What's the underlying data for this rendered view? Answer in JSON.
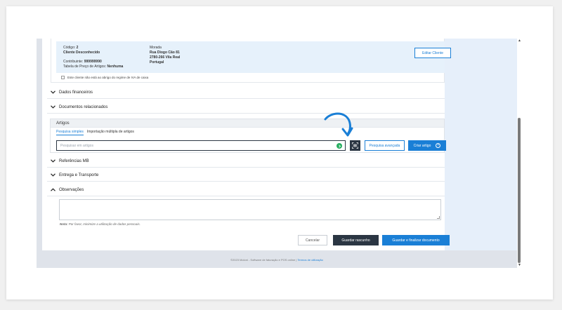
{
  "customer": {
    "code_label": "Código:",
    "code_value": "2",
    "name": "Cliente Desconhecido",
    "taxpayer_label": "Contribuinte:",
    "taxpayer_value": "999999990",
    "price_table_label": "Tabela de Preço de Artigos:",
    "price_table_value": "Nenhuma",
    "address_label": "Morada",
    "address_line1": "Rua Diogo Cão 81",
    "address_line2": "2780-266 Vila Real",
    "address_line3": "Portugal",
    "edit_button": "Editar Cliente",
    "vat_checkbox_label": "Este cliente não está ao abrigo do regime de IVA de caixa"
  },
  "sections": {
    "financial": "Dados financeiros",
    "related_docs": "Documentos relacionados",
    "mb_refs": "Referências MB",
    "delivery": "Entrega e Transporte",
    "observations": "Observações"
  },
  "articles": {
    "title": "Artigos",
    "tabs": [
      "Pesquisa simples",
      "Importação múltipla de artigos"
    ],
    "active_tab": 0,
    "search_placeholder": "Pesquisar em artigos",
    "advanced_button": "Pesquisa avançada",
    "create_button": "Criar artigo"
  },
  "observations": {
    "note_label": "Nota:",
    "note_text": "Por favor, minimize a utilização de dados pessoais."
  },
  "actions": {
    "cancel": "Cancelar",
    "draft": "Guardar rascunho",
    "finalize": "Guardar e finalizar documento"
  },
  "footer": {
    "text": "©2023 Moloni - Software de faturação e POS online |",
    "link": "Termos de utilização"
  },
  "icons": {
    "scan": "barcode-scan-icon",
    "search_go": "search-arrow-icon",
    "create": "plus-circle-icon",
    "annotation": "curved-arrow-icon"
  },
  "colors": {
    "accent": "#1a7fd6",
    "dark": "#2b3643",
    "customer_bg": "#e6f1fb",
    "go_green": "#27ae60"
  }
}
